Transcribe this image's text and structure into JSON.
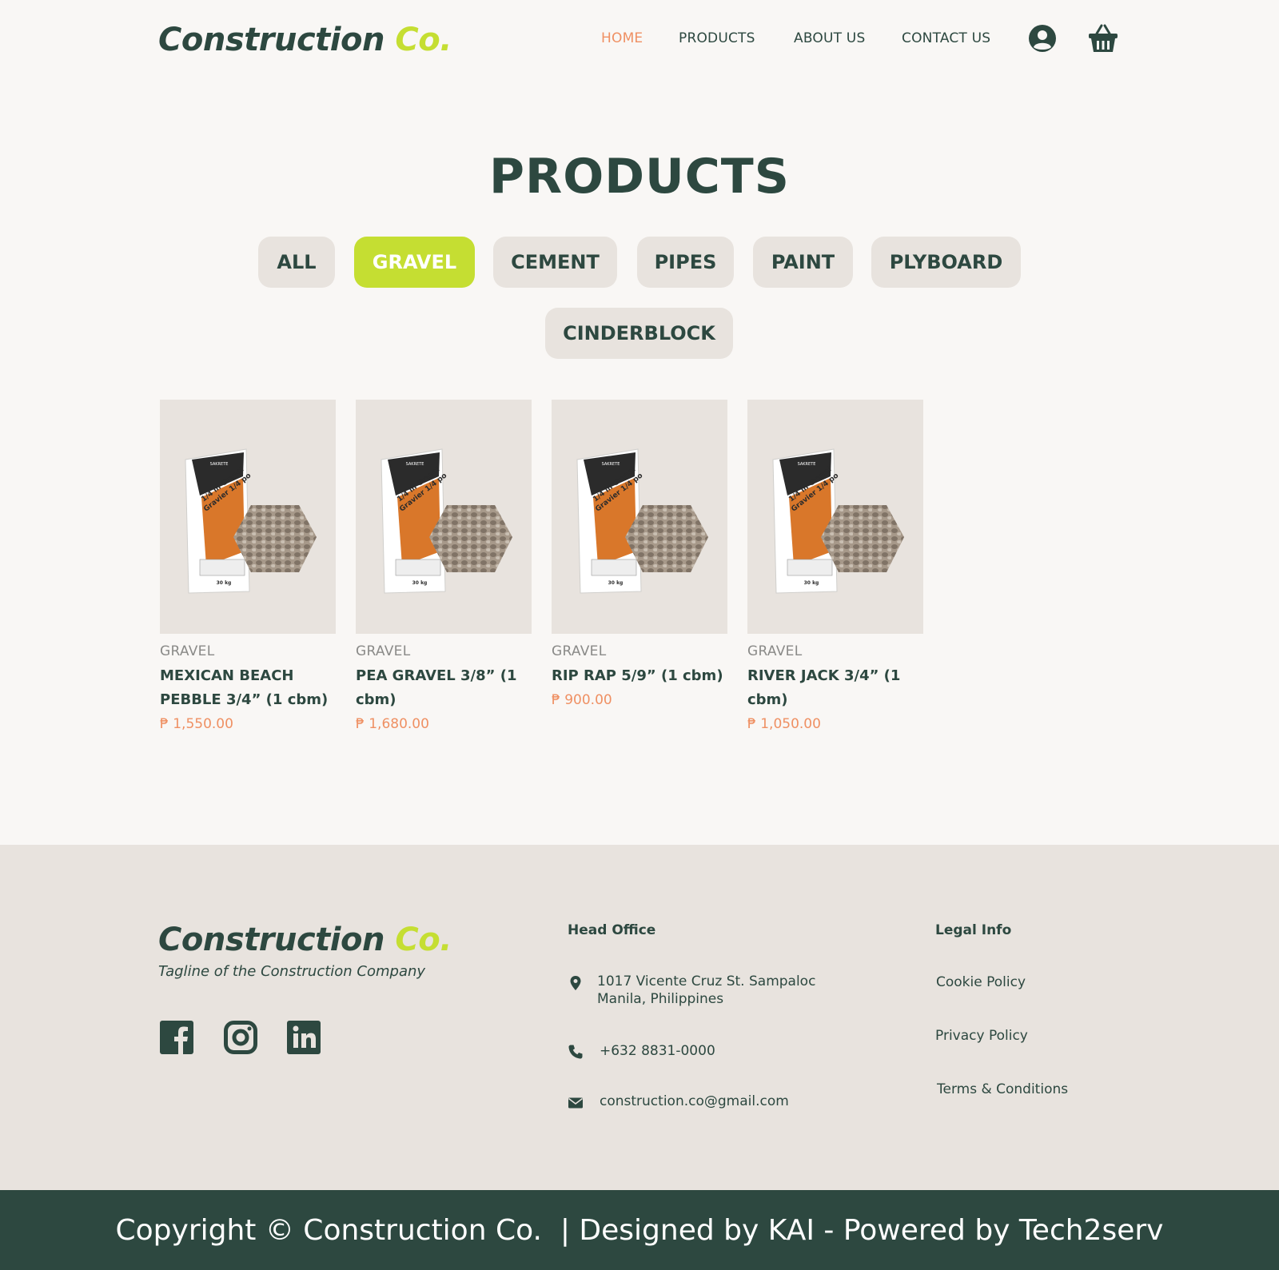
{
  "brand": {
    "name_main": "Construction",
    "name_accent": "Co.",
    "tagline": "Tagline of the Construction Company"
  },
  "colors": {
    "primary": "#2d4840",
    "accent": "#c5de32",
    "highlight": "#ef9063",
    "background": "#f9f7f5",
    "panel": "#e8e3de"
  },
  "nav": {
    "items": [
      {
        "label": "HOME",
        "active": true
      },
      {
        "label": "PRODUCTS",
        "active": false
      },
      {
        "label": "ABOUT US",
        "active": false
      },
      {
        "label": "CONTACT US",
        "active": false
      }
    ],
    "icons": [
      "user-icon",
      "cart-icon"
    ]
  },
  "products_section": {
    "title": "PRODUCTS",
    "filters": [
      {
        "label": "ALL",
        "active": false
      },
      {
        "label": "GRAVEL",
        "active": true
      },
      {
        "label": "CEMENT",
        "active": false
      },
      {
        "label": "PIPES",
        "active": false
      },
      {
        "label": "PAINT",
        "active": false
      },
      {
        "label": "PLYBOARD",
        "active": false
      },
      {
        "label": "CINDERBLOCK",
        "active": false
      }
    ],
    "items": [
      {
        "category": "GRAVEL",
        "name": "MEXICAN BEACH PEBBLE 3/4” (1 cbm)",
        "price": "₱ 1,550.00",
        "bag_line1": "1/4 in Gravel",
        "bag_line2": "Gravier 1/4 po",
        "bag_brand": "SAKRETE",
        "bag_weight": "30 kg"
      },
      {
        "category": "GRAVEL",
        "name": "PEA GRAVEL 3/8” (1 cbm)",
        "price": "₱ 1,680.00",
        "bag_line1": "1/4 in Gravel",
        "bag_line2": "Gravier 1/4 po",
        "bag_brand": "SAKRETE",
        "bag_weight": "30 kg"
      },
      {
        "category": "GRAVEL",
        "name": "RIP RAP 5/9” (1 cbm)",
        "price": "₱ 900.00",
        "bag_line1": "1/4 in Gravel",
        "bag_line2": "Gravier 1/4 po",
        "bag_brand": "SAKRETE",
        "bag_weight": "30 kg"
      },
      {
        "category": "GRAVEL",
        "name": "RIVER JACK 3/4” (1 cbm)",
        "price": "₱ 1,050.00",
        "bag_line1": "1/4 in Gravel",
        "bag_line2": "Gravier 1/4 po",
        "bag_brand": "SAKRETE",
        "bag_weight": "30 kg"
      }
    ]
  },
  "footer": {
    "socials": [
      "facebook-icon",
      "instagram-icon",
      "linkedin-icon"
    ],
    "head_office": {
      "heading": "Head Office",
      "address_line1": "1017 Vicente Cruz St. Sampaloc",
      "address_line2": "Manila, Philippines",
      "phone": "+632 8831-0000",
      "email": "construction.co@gmail.com"
    },
    "legal": {
      "heading": "Legal Info",
      "links": [
        "Cookie Policy",
        "Privacy Policy",
        "Terms & Conditions"
      ]
    },
    "copyright": "Copyright © Construction Co.  | Designed by KAI - Powered by Tech2serv"
  }
}
